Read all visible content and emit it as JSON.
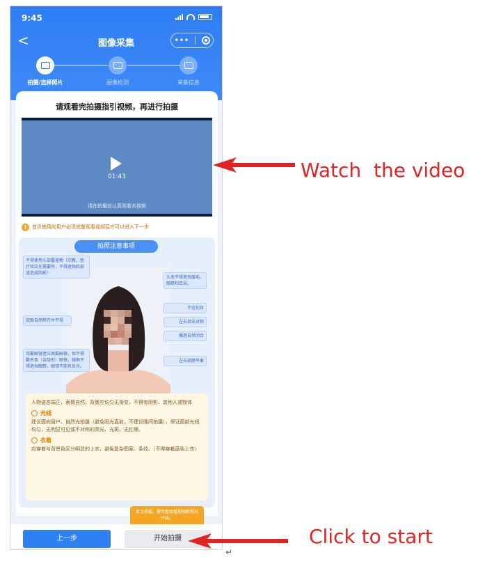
{
  "status_bar": {
    "time": "9:45"
  },
  "nav": {
    "back_glyph": "<",
    "title": "图像采集",
    "menu_glyph": "•••"
  },
  "steps": [
    {
      "label": "拍摄/选择照片",
      "icon": "photo-icon",
      "active": true
    },
    {
      "label": "图像检测",
      "icon": "face-scan-icon",
      "active": false
    },
    {
      "label": "采集信息",
      "icon": "info-card-icon",
      "active": false
    }
  ],
  "guide": {
    "title": "请观看完拍摄指引视频，再进行拍摄",
    "video_duration": "01:43",
    "video_subtitle": "请在拍摄前认真观看本视频",
    "tip": "首次使用的用户必须完整观看视频后才可以进入下一步"
  },
  "notes": {
    "title": "拍照注意事项",
    "callouts": {
      "c1": "不得使用头部覆盖物（宗教、医疗和文化需要时，不得遮挡脸部或造成阴影）",
      "c2": "头发不得遮挡眉毛、眼睛和耳朵。",
      "c3": "不宜化妆",
      "c4": "双眼自然睁开并平视",
      "c5": "左右耳朵对称",
      "c6": "嘴唇自然闭合",
      "c7": "常戴眼镜者应佩戴眼镜，但不得戴有色（含隐形）眼镜，镜框不得遮挡眼睛，眼镜不能有反光。",
      "c8": "左右肩膀平衡"
    },
    "posture": "人物姿态端正，表情自然，背景应均匀无渐变，不得有阴影、其他人或物体",
    "light_heading": "光线",
    "light_text": "建议面向窗户、自然光拍摄（避免阳光直射，不建议晚间拍摄），保证面部光线均匀，无明显可见或不对称的高光、光斑、无红眼。",
    "clothing_heading": "衣着",
    "clothing_text": "应穿着与背景色区分明显的上衣，避免复杂图案、条纹。（不得穿着蓝色上衣）"
  },
  "footer": {
    "prev_label": "上一步",
    "start_label": "开始拍摄",
    "tooltip": "首次拍摄，需完整观看视频教程后开始。"
  },
  "annotations": {
    "watch": "Watch  the video",
    "start": "Click to start",
    "color": "#e02424"
  },
  "return_mark": "↵"
}
